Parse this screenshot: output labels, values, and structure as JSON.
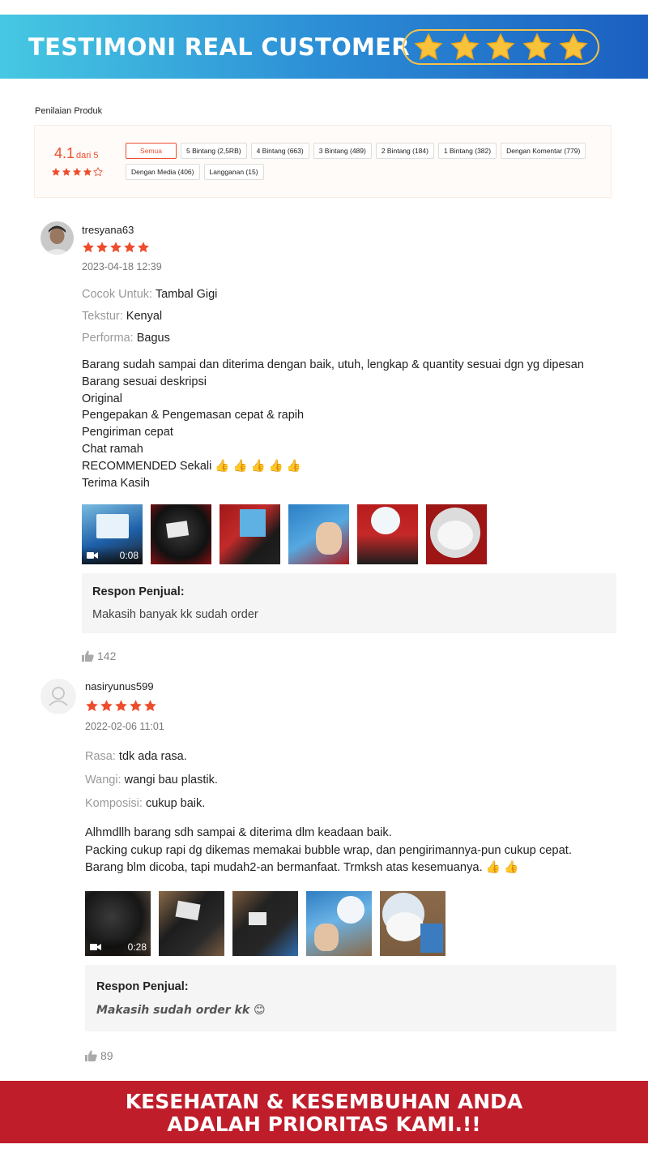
{
  "banner": {
    "title": "TESTIMONI REAL CUSTOMER",
    "stars": 5
  },
  "rating": {
    "heading": "Penilaian Produk",
    "score": "4.1",
    "out_of": "dari 5",
    "stars_value": 4.1,
    "filters": [
      "Semua",
      "5 Bintang (2,5RB)",
      "4 Bintang (663)",
      "3 Bintang (489)",
      "2 Bintang (184)",
      "1 Bintang (382)",
      "Dengan Komentar (779)",
      "Dengan Media (406)",
      "Langganan (15)"
    ]
  },
  "reviews": [
    {
      "username": "tresyana63",
      "stars": 5,
      "date": "2023-04-18 12:39",
      "attributes": [
        {
          "key": "Cocok Untuk:",
          "value": "Tambal Gigi"
        },
        {
          "key": "Tekstur:",
          "value": "Kenyal"
        },
        {
          "key": "Performa:",
          "value": "Bagus"
        }
      ],
      "lines": [
        "Barang sudah sampai dan diterima dengan baik, utuh, lengkap & quantity sesuai dgn yg dipesan",
        "Barang sesuai deskripsi",
        "Original",
        "Pengepakan & Pengemasan cepat & rapih",
        "Pengiriman cepat",
        "Chat ramah",
        "RECOMMENDED Sekali 👍 👍 👍 👍 👍",
        "Terima Kasih"
      ],
      "video_duration": "0:08",
      "seller_label": "Respon Penjual:",
      "seller_reply": "Makasih banyak kk sudah order",
      "likes": "142"
    },
    {
      "username": "nasiryunus599",
      "stars": 5,
      "date": "2022-02-06 11:01",
      "attributes": [
        {
          "key": "Rasa:",
          "value": "tdk ada rasa."
        },
        {
          "key": "Wangi:",
          "value": "wangi bau plastik."
        },
        {
          "key": "Komposisi:",
          "value": "cukup baik."
        }
      ],
      "lines": [
        "Alhmdllh barang sdh sampai & diterima dlm keadaan baik.",
        "Packing cukup rapi dg dikemas memakai bubble wrap, dan pengirimannya-pun cukup cepat.",
        "Barang blm dicoba, tapi mudah2-an bermanfaat.  Trmksh atas kesemuanya. 👍 👍"
      ],
      "video_duration": "0:28",
      "seller_label": "Respon Penjual:",
      "seller_reply": "Makasih sudah order kk 😊",
      "likes": "89"
    }
  ],
  "footer": {
    "line1": "KESEHATAN & KESEMBUHAN ANDA",
    "line2": "ADALAH PRIORITAS KAMI.!!"
  },
  "colors": {
    "accent": "#ee4d2d",
    "banner_start": "#46c8e2",
    "banner_end": "#1b5fc0",
    "footer_bg": "#c01d2b",
    "star_gold": "#f8c23a"
  }
}
